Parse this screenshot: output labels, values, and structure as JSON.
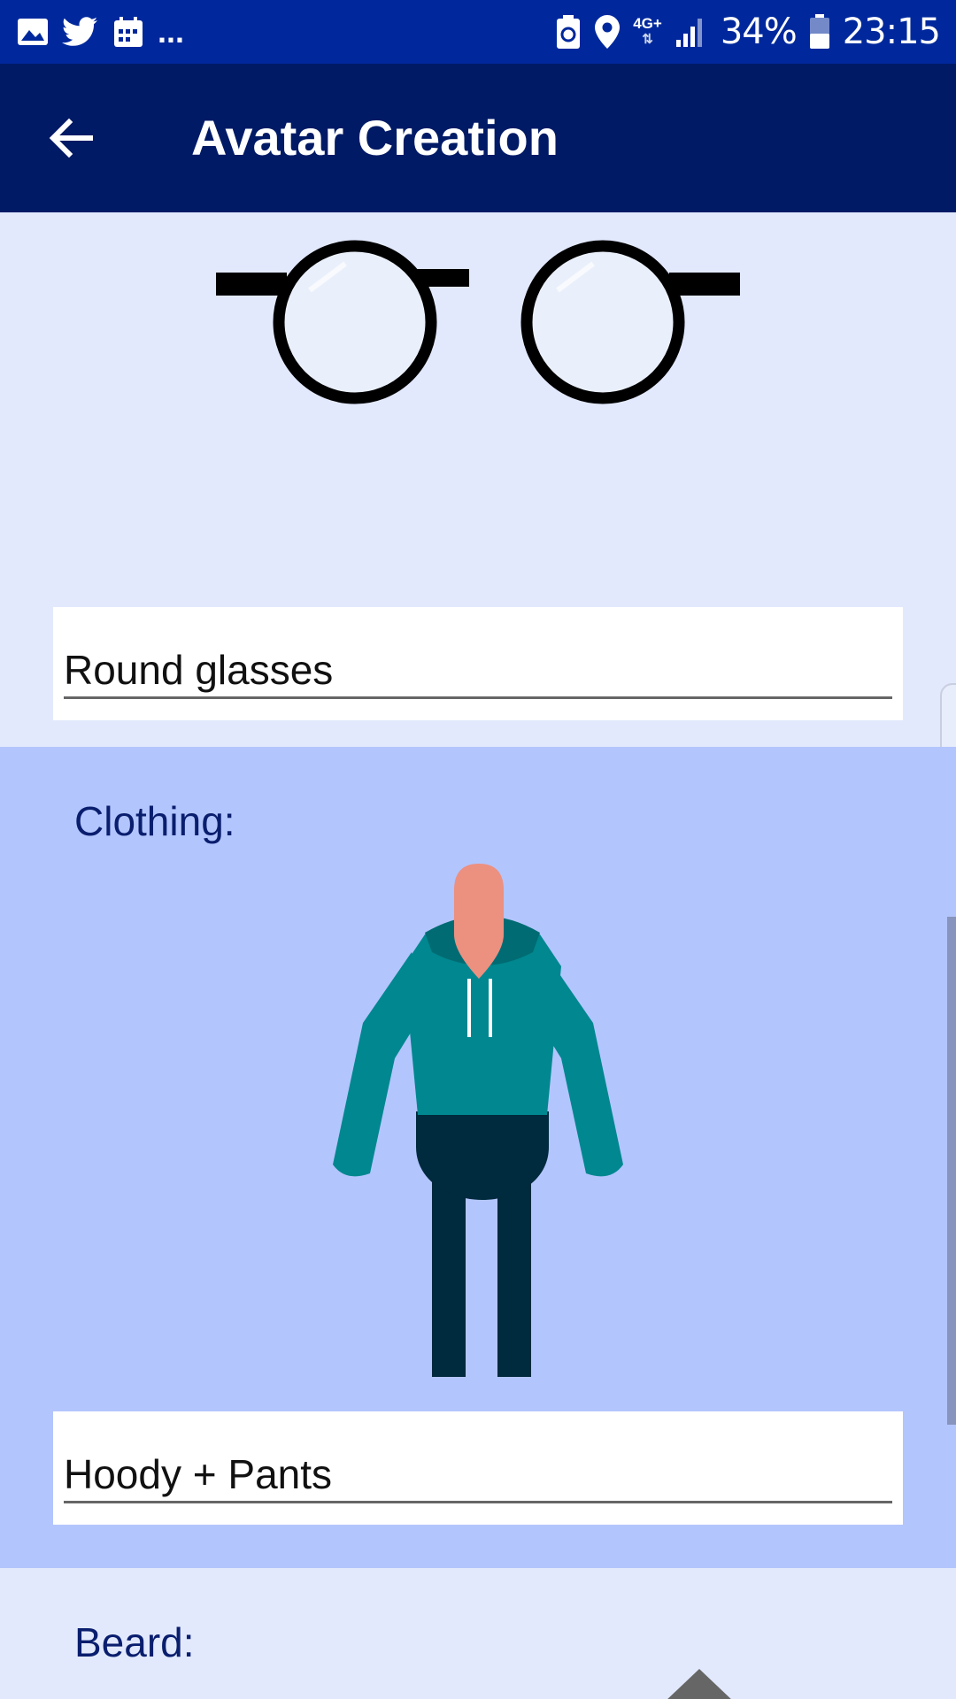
{
  "status_bar": {
    "battery": "34%",
    "time": "23:15",
    "network": "4G+",
    "overflow": "..."
  },
  "app_bar": {
    "title": "Avatar Creation"
  },
  "glasses": {
    "value": "Round glasses"
  },
  "clothing": {
    "label": "Clothing:",
    "value": "Hoody + Pants"
  },
  "beard": {
    "label": "Beard:"
  },
  "colors": {
    "status_bar": "#00289c",
    "app_bar": "#001a66",
    "section_light": "#e2e9fd",
    "section_highlight": "#b3c5fd",
    "label_text": "#0a1e6e"
  }
}
